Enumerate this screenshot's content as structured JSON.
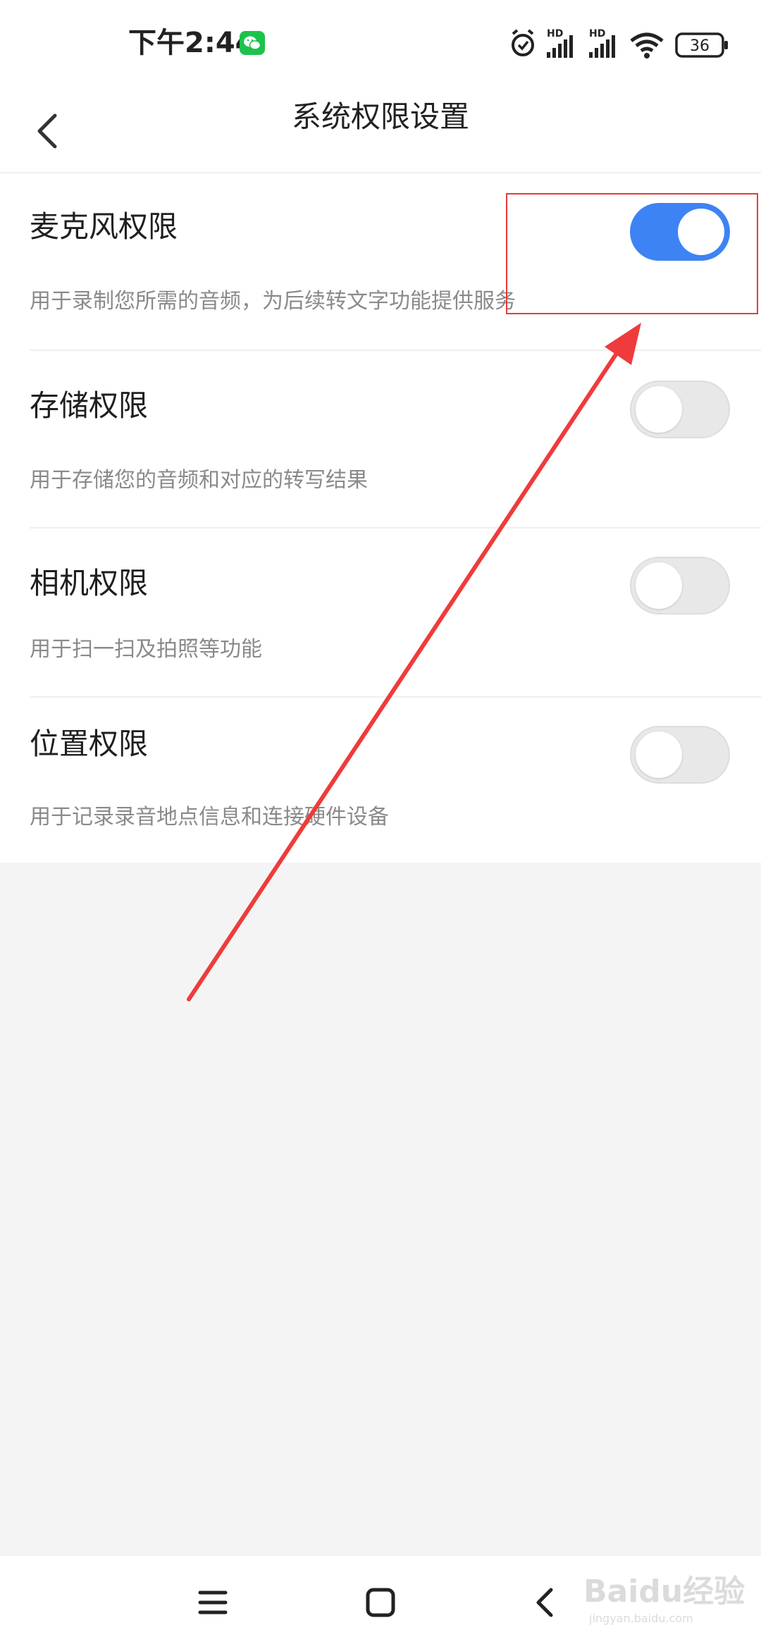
{
  "status_bar": {
    "time": "下午2:44",
    "app_icon": "wechat-icon",
    "signal_label_1": "HD",
    "signal_label_2": "HD",
    "battery": "36"
  },
  "header": {
    "title": "系统权限设置",
    "back_icon": "chevron-left-icon"
  },
  "permissions": [
    {
      "title": "麦克风权限",
      "desc": "用于录制您所需的音频，为后续转文字功能提供服务",
      "enabled": true
    },
    {
      "title": "存储权限",
      "desc": "用于存储您的音频和对应的转写结果",
      "enabled": false
    },
    {
      "title": "相机权限",
      "desc": "用于扫一扫及拍照等功能",
      "enabled": false
    },
    {
      "title": "位置权限",
      "desc": "用于记录录音地点信息和连接硬件设备",
      "enabled": false
    }
  ],
  "nav_bar": {
    "menu_icon": "menu-icon",
    "home_icon": "home-icon",
    "back_icon": "back-icon"
  },
  "watermark": {
    "brand": "Baidu经验",
    "site": "jingyan.baidu.com"
  },
  "colors": {
    "accent": "#3e83f4",
    "annotation": "#e83a3a",
    "toggle_off": "#e8e8e8"
  }
}
